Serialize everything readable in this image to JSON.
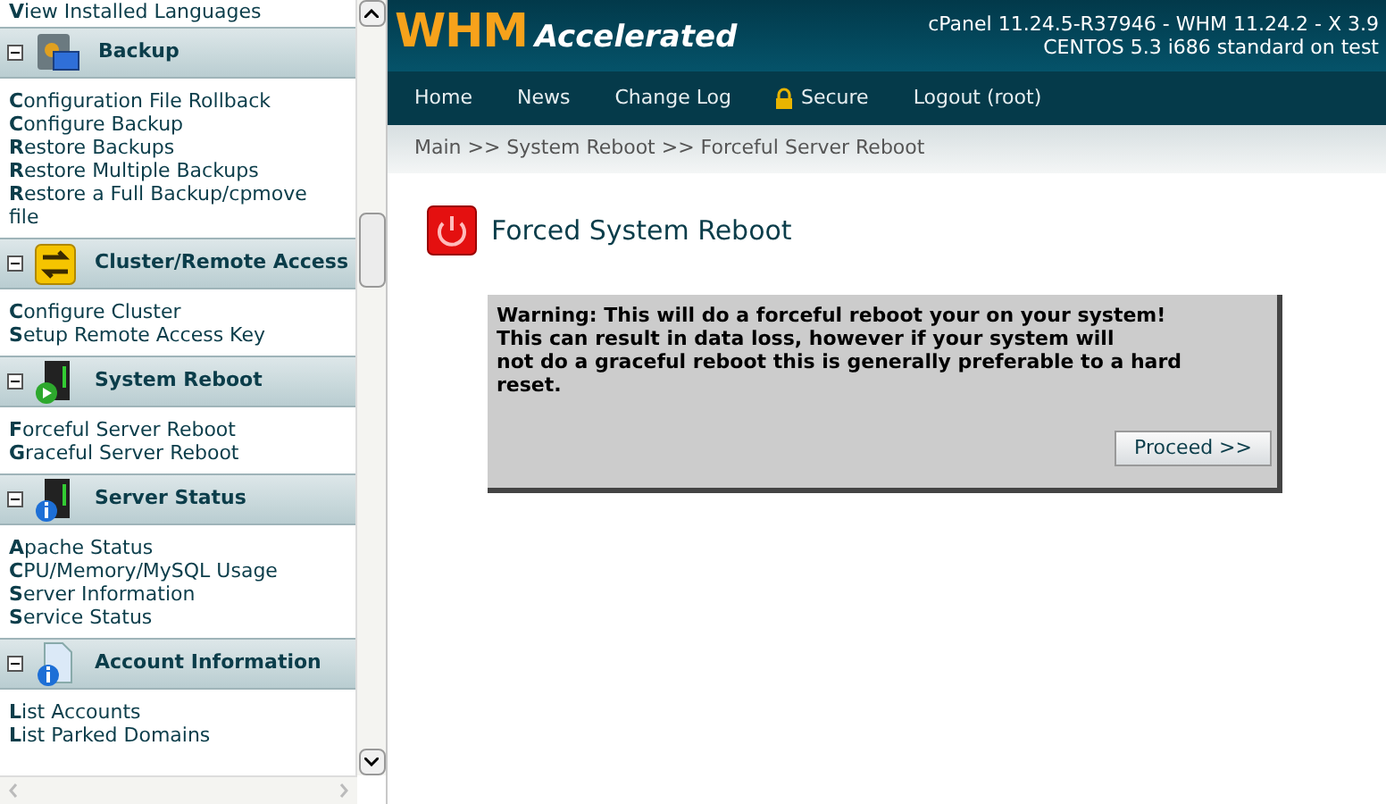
{
  "sidebar": {
    "top_links": [
      "**V**iew Installed Languages"
    ],
    "sections": [
      {
        "title": "Backup",
        "kind": "backup",
        "expanded": true,
        "links": [
          "**C**onfiguration File Rollback",
          "**C**onfigure Backup",
          "**R**estore Backups",
          "**R**estore Multiple Backups",
          "**R**estore a Full Backup/cpmove file"
        ]
      },
      {
        "title": "Cluster/Remote Access",
        "kind": "cluster",
        "expanded": true,
        "links": [
          "**C**onfigure Cluster",
          "**S**etup Remote Access Key"
        ]
      },
      {
        "title": "System Reboot",
        "kind": "reboot",
        "expanded": true,
        "links": [
          "**F**orceful Server Reboot",
          "**G**raceful Server Reboot"
        ]
      },
      {
        "title": "Server Status",
        "kind": "status",
        "expanded": true,
        "links": [
          "**A**pache Status",
          "**C**PU/Memory/MySQL Usage",
          "**S**erver Information",
          "**S**ervice Status"
        ]
      },
      {
        "title": "Account Information",
        "kind": "account",
        "expanded": true,
        "links": [
          "**L**ist Accounts",
          "**L**ist Parked Domains"
        ]
      }
    ]
  },
  "header": {
    "logo_main": "WHM",
    "logo_sub": "Accelerated",
    "version": "cPanel 11.24.5-R37946 - WHM 11.24.2 - X 3.9",
    "system": "CENTOS 5.3 i686 standard on test"
  },
  "nav": [
    {
      "label": "Home",
      "kind": "plain"
    },
    {
      "label": "News",
      "kind": "plain"
    },
    {
      "label": "Change Log",
      "kind": "plain"
    },
    {
      "label": "Secure",
      "kind": "secure"
    },
    {
      "label": "Logout (root)",
      "kind": "plain"
    }
  ],
  "breadcrumb": "Main >> System Reboot >> Forceful Server Reboot",
  "page_title": "Forced System Reboot",
  "warning": {
    "lines": [
      "Warning: This will do a forceful reboot your on your system!",
      "This can result in data loss, however if your system will",
      "not do a graceful reboot this is generally preferable to a hard",
      "reset."
    ],
    "button": "Proceed >>"
  }
}
